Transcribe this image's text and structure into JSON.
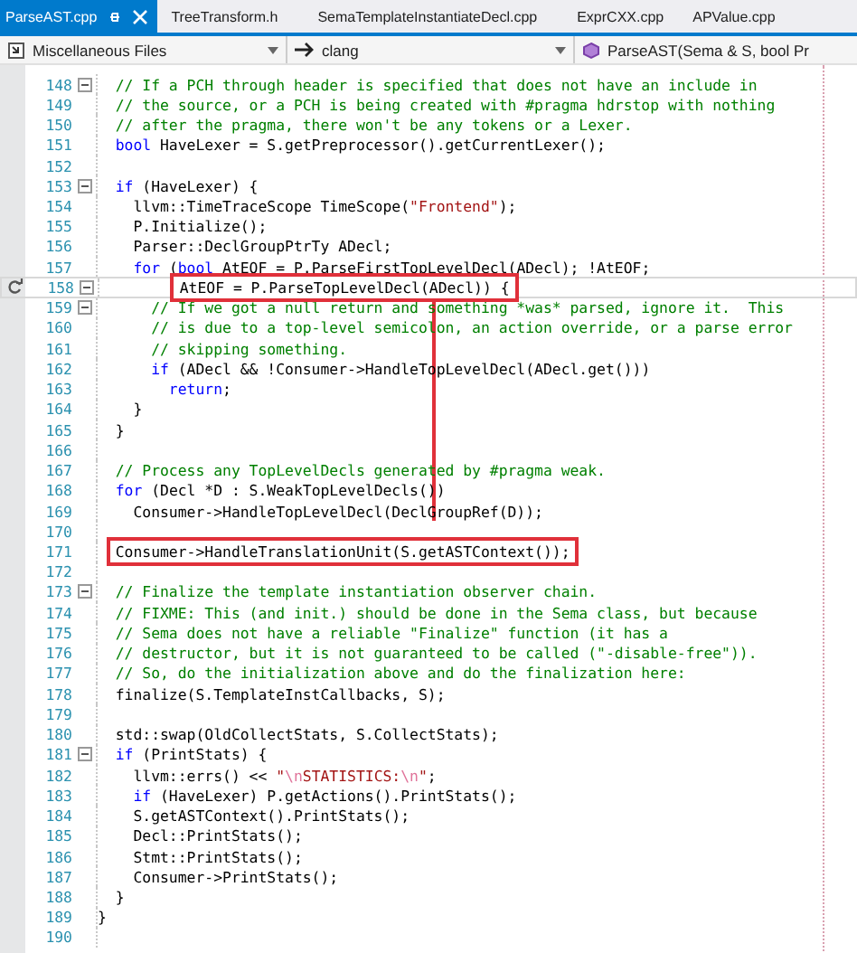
{
  "tabs": [
    {
      "label": "ParseAST.cpp",
      "selected": true
    },
    {
      "label": "TreeTransform.h",
      "selected": false
    },
    {
      "label": "SemaTemplateInstantiateDecl.cpp",
      "selected": false
    },
    {
      "label": "ExprCXX.cpp",
      "selected": false
    },
    {
      "label": "APValue.cpp",
      "selected": false
    }
  ],
  "navigation": {
    "project": "Miscellaneous Files",
    "scope": "clang",
    "member": "ParseAST(Sema & S, bool Pr"
  },
  "lines": [
    {
      "number": "148",
      "fold": true,
      "current": false,
      "box": false,
      "tokens": [
        {
          "kind": "comment",
          "text": "  // If a PCH through header is specified that does not have an include in"
        }
      ]
    },
    {
      "number": "149",
      "fold": false,
      "current": false,
      "box": false,
      "tokens": [
        {
          "kind": "comment",
          "text": "  // the source, or a PCH is being created with #pragma hdrstop with nothing"
        }
      ]
    },
    {
      "number": "150",
      "fold": false,
      "current": false,
      "box": false,
      "tokens": [
        {
          "kind": "comment",
          "text": "  // after the pragma, there won't be any tokens or a Lexer."
        }
      ]
    },
    {
      "number": "151",
      "fold": false,
      "current": false,
      "box": false,
      "tokens": [
        {
          "kind": "keyword",
          "text": "  bool"
        },
        {
          "kind": "plain",
          "text": " HaveLexer = S.getPreprocessor().getCurrentLexer();"
        }
      ]
    },
    {
      "number": "152",
      "fold": false,
      "current": false,
      "box": false
    },
    {
      "number": "153",
      "fold": true,
      "current": false,
      "box": false,
      "tokens": [
        {
          "kind": "keyword",
          "text": "  if"
        },
        {
          "kind": "plain",
          "text": " (HaveLexer) {"
        }
      ]
    },
    {
      "number": "154",
      "fold": false,
      "current": false,
      "box": false,
      "tokens": [
        {
          "kind": "plain",
          "text": "    llvm::TimeTraceScope TimeScope("
        },
        {
          "kind": "string",
          "text": "\"Frontend\""
        },
        {
          "kind": "plain",
          "text": ");"
        }
      ]
    },
    {
      "number": "155",
      "fold": false,
      "current": false,
      "box": false,
      "tokens": [
        {
          "kind": "plain",
          "text": "    P.Initialize();"
        }
      ]
    },
    {
      "number": "156",
      "fold": false,
      "current": false,
      "box": false,
      "tokens": [
        {
          "kind": "plain",
          "text": "    Parser::DeclGroupPtrTy ADecl;"
        }
      ]
    },
    {
      "number": "157",
      "fold": false,
      "current": false,
      "box": false,
      "tokens": [
        {
          "kind": "keyword",
          "text": "    for"
        },
        {
          "kind": "plain",
          "text": " ("
        },
        {
          "kind": "keyword",
          "text": "bool"
        },
        {
          "kind": "plain",
          "text": " AtEOF = P.ParseFirstTopLevelDecl(ADecl); !AtEOF;"
        }
      ]
    },
    {
      "number": "158",
      "fold": true,
      "current": true,
      "box": true,
      "tokens": [
        {
          "kind": "plain",
          "text": "         AtEOF = P.ParseTopLevelDecl(ADecl)) {"
        }
      ]
    },
    {
      "number": "159",
      "fold": true,
      "current": false,
      "box": false,
      "tokens": [
        {
          "kind": "comment",
          "text": "      // If we got a null return and something *was* parsed, ignore it.  This"
        }
      ]
    },
    {
      "number": "160",
      "fold": false,
      "current": false,
      "box": false,
      "tokens": [
        {
          "kind": "comment",
          "text": "      // is due to a top-level semicolon, an action override, or a parse error"
        }
      ]
    },
    {
      "number": "161",
      "fold": false,
      "current": false,
      "box": false,
      "tokens": [
        {
          "kind": "comment",
          "text": "      // skipping something."
        }
      ]
    },
    {
      "number": "162",
      "fold": false,
      "current": false,
      "box": false,
      "tokens": [
        {
          "kind": "keyword",
          "text": "      if"
        },
        {
          "kind": "plain",
          "text": " (ADecl && !Consumer->HandleTopLevelDecl(ADecl.get()))"
        }
      ]
    },
    {
      "number": "163",
      "fold": false,
      "current": false,
      "box": false,
      "tokens": [
        {
          "kind": "keyword",
          "text": "        return"
        },
        {
          "kind": "plain",
          "text": ";"
        }
      ]
    },
    {
      "number": "164",
      "fold": false,
      "current": false,
      "box": false,
      "tokens": [
        {
          "kind": "plain",
          "text": "    }"
        }
      ]
    },
    {
      "number": "165",
      "fold": false,
      "current": false,
      "box": false,
      "tokens": [
        {
          "kind": "plain",
          "text": "  }"
        }
      ]
    },
    {
      "number": "166",
      "fold": false,
      "current": false,
      "box": false
    },
    {
      "number": "167",
      "fold": false,
      "current": false,
      "box": false,
      "tokens": [
        {
          "kind": "comment",
          "text": "  // Process any TopLevelDecls generated by #pragma weak."
        }
      ]
    },
    {
      "number": "168",
      "fold": false,
      "current": false,
      "box": false,
      "tokens": [
        {
          "kind": "keyword",
          "text": "  for"
        },
        {
          "kind": "plain",
          "text": " (Decl *D : S.WeakTopLevelDecls())"
        }
      ]
    },
    {
      "number": "169",
      "fold": false,
      "current": false,
      "box": false,
      "tokens": [
        {
          "kind": "plain",
          "text": "    Consumer->HandleTopLevelDecl(DeclGroupRef(D));"
        }
      ]
    },
    {
      "number": "170",
      "fold": false,
      "current": false,
      "box": false
    },
    {
      "number": "171",
      "fold": false,
      "current": false,
      "box": true,
      "tokens": [
        {
          "kind": "plain",
          "text": "  Consumer->HandleTranslationUnit(S.getASTContext());"
        }
      ]
    },
    {
      "number": "172",
      "fold": false,
      "current": false,
      "box": false
    },
    {
      "number": "173",
      "fold": true,
      "current": false,
      "box": false,
      "tokens": [
        {
          "kind": "comment",
          "text": "  // Finalize the template instantiation observer chain."
        }
      ]
    },
    {
      "number": "174",
      "fold": false,
      "current": false,
      "box": false,
      "tokens": [
        {
          "kind": "comment",
          "text": "  // FIXME: This (and init.) should be done in the Sema class, but because"
        }
      ]
    },
    {
      "number": "175",
      "fold": false,
      "current": false,
      "box": false,
      "tokens": [
        {
          "kind": "comment",
          "text": "  // Sema does not have a reliable \"Finalize\" function (it has a"
        }
      ]
    },
    {
      "number": "176",
      "fold": false,
      "current": false,
      "box": false,
      "tokens": [
        {
          "kind": "comment",
          "text": "  // destructor, but it is not guaranteed to be called (\"-disable-free\"))."
        }
      ]
    },
    {
      "number": "177",
      "fold": false,
      "current": false,
      "box": false,
      "tokens": [
        {
          "kind": "comment",
          "text": "  // So, do the initialization above and do the finalization here:"
        }
      ]
    },
    {
      "number": "178",
      "fold": false,
      "current": false,
      "box": false,
      "tokens": [
        {
          "kind": "plain",
          "text": "  finalize(S.TemplateInstCallbacks, S);"
        }
      ]
    },
    {
      "number": "179",
      "fold": false,
      "current": false,
      "box": false
    },
    {
      "number": "180",
      "fold": false,
      "current": false,
      "box": false,
      "tokens": [
        {
          "kind": "plain",
          "text": "  std::swap(OldCollectStats, S.CollectStats);"
        }
      ]
    },
    {
      "number": "181",
      "fold": true,
      "current": false,
      "box": false,
      "tokens": [
        {
          "kind": "keyword",
          "text": "  if"
        },
        {
          "kind": "plain",
          "text": " (PrintStats) {"
        }
      ]
    },
    {
      "number": "182",
      "fold": false,
      "current": false,
      "box": false,
      "tokens": [
        {
          "kind": "plain",
          "text": "    llvm::errs() << "
        },
        {
          "kind": "string",
          "text": "\""
        },
        {
          "kind": "escape",
          "text": "\\n"
        },
        {
          "kind": "string",
          "text": "STATISTICS:"
        },
        {
          "kind": "escape",
          "text": "\\n"
        },
        {
          "kind": "string",
          "text": "\""
        },
        {
          "kind": "plain",
          "text": ";"
        }
      ]
    },
    {
      "number": "183",
      "fold": false,
      "current": false,
      "box": false,
      "tokens": [
        {
          "kind": "keyword",
          "text": "    if"
        },
        {
          "kind": "plain",
          "text": " (HaveLexer) P.getActions().PrintStats();"
        }
      ]
    },
    {
      "number": "184",
      "fold": false,
      "current": false,
      "box": false,
      "tokens": [
        {
          "kind": "plain",
          "text": "    S.getASTContext().PrintStats();"
        }
      ]
    },
    {
      "number": "185",
      "fold": false,
      "current": false,
      "box": false,
      "tokens": [
        {
          "kind": "plain",
          "text": "    Decl::PrintStats();"
        }
      ]
    },
    {
      "number": "186",
      "fold": false,
      "current": false,
      "box": false,
      "tokens": [
        {
          "kind": "plain",
          "text": "    Stmt::PrintStats();"
        }
      ]
    },
    {
      "number": "187",
      "fold": false,
      "current": false,
      "box": false,
      "tokens": [
        {
          "kind": "plain",
          "text": "    Consumer->PrintStats();"
        }
      ]
    },
    {
      "number": "188",
      "fold": false,
      "current": false,
      "box": false,
      "tokens": [
        {
          "kind": "plain",
          "text": "  }"
        }
      ]
    },
    {
      "number": "189",
      "fold": false,
      "current": false,
      "box": false,
      "tokens": [
        {
          "kind": "plain",
          "text": "}"
        }
      ]
    },
    {
      "number": "190",
      "fold": false,
      "current": false,
      "box": false
    }
  ]
}
